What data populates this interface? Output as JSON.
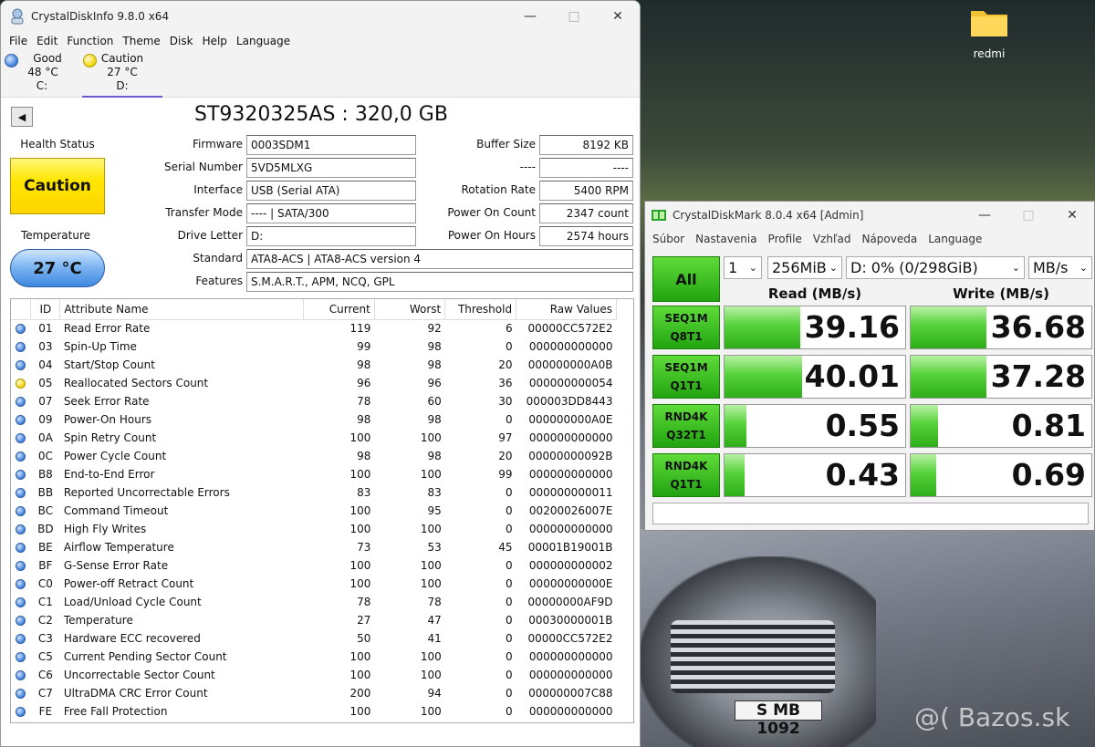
{
  "desktop": {
    "folder_label": "redmi",
    "plate": "S MB 1092",
    "watermark": "@( Bazos.sk"
  },
  "cdi": {
    "title": "CrystalDiskInfo 9.8.0 x64",
    "menu": [
      "File",
      "Edit",
      "Function",
      "Theme",
      "Disk",
      "Help",
      "Language"
    ],
    "drives": [
      {
        "status": "Good",
        "temp": "48 °C",
        "letter": "C:"
      },
      {
        "status": "Caution",
        "temp": "27 °C",
        "letter": "D:"
      }
    ],
    "disk_title": "ST9320325AS : 320,0 GB",
    "health_label": "Health Status",
    "health_value": "Caution",
    "temp_label": "Temperature",
    "temp_value": "27 °C",
    "fields": {
      "firmware_label": "Firmware",
      "firmware": "0003SDM1",
      "serial_label": "Serial Number",
      "serial": "5VD5MLXG",
      "interface_label": "Interface",
      "interface": "USB (Serial ATA)",
      "transfer_label": "Transfer Mode",
      "transfer": "---- | SATA/300",
      "drive_letter_label": "Drive Letter",
      "drive_letter": "D:",
      "standard_label": "Standard",
      "standard": "ATA8-ACS | ATA8-ACS version 4",
      "features_label": "Features",
      "features": "S.M.A.R.T., APM, NCQ, GPL",
      "buffer_label": "Buffer Size",
      "buffer": "8192 KB",
      "blank_label": "----",
      "blank": "----",
      "rotation_label": "Rotation Rate",
      "rotation": "5400 RPM",
      "power_count_label": "Power On Count",
      "power_count": "2347 count",
      "power_hours_label": "Power On Hours",
      "power_hours": "2574 hours"
    },
    "smart_headers": [
      "ID",
      "Attribute Name",
      "Current",
      "Worst",
      "Threshold",
      "Raw Values"
    ],
    "smart_rows": [
      [
        "blue",
        "01",
        "Read Error Rate",
        "119",
        "92",
        "6",
        "00000CC572E2"
      ],
      [
        "blue",
        "03",
        "Spin-Up Time",
        "99",
        "98",
        "0",
        "000000000000"
      ],
      [
        "blue",
        "04",
        "Start/Stop Count",
        "98",
        "98",
        "20",
        "000000000A0B"
      ],
      [
        "yellow",
        "05",
        "Reallocated Sectors Count",
        "96",
        "96",
        "36",
        "000000000054"
      ],
      [
        "blue",
        "07",
        "Seek Error Rate",
        "78",
        "60",
        "30",
        "000003DD8443"
      ],
      [
        "blue",
        "09",
        "Power-On Hours",
        "98",
        "98",
        "0",
        "000000000A0E"
      ],
      [
        "blue",
        "0A",
        "Spin Retry Count",
        "100",
        "100",
        "97",
        "000000000000"
      ],
      [
        "blue",
        "0C",
        "Power Cycle Count",
        "98",
        "98",
        "20",
        "00000000092B"
      ],
      [
        "blue",
        "B8",
        "End-to-End Error",
        "100",
        "100",
        "99",
        "000000000000"
      ],
      [
        "blue",
        "BB",
        "Reported Uncorrectable Errors",
        "83",
        "83",
        "0",
        "000000000011"
      ],
      [
        "blue",
        "BC",
        "Command Timeout",
        "100",
        "95",
        "0",
        "00200026007E"
      ],
      [
        "blue",
        "BD",
        "High Fly Writes",
        "100",
        "100",
        "0",
        "000000000000"
      ],
      [
        "blue",
        "BE",
        "Airflow Temperature",
        "73",
        "53",
        "45",
        "00001B19001B"
      ],
      [
        "blue",
        "BF",
        "G-Sense Error Rate",
        "100",
        "100",
        "0",
        "000000000002"
      ],
      [
        "blue",
        "C0",
        "Power-off Retract Count",
        "100",
        "100",
        "0",
        "00000000000E"
      ],
      [
        "blue",
        "C1",
        "Load/Unload Cycle Count",
        "78",
        "78",
        "0",
        "00000000AF9D"
      ],
      [
        "blue",
        "C2",
        "Temperature",
        "27",
        "47",
        "0",
        "00030000001B"
      ],
      [
        "blue",
        "C3",
        "Hardware ECC recovered",
        "50",
        "41",
        "0",
        "00000CC572E2"
      ],
      [
        "blue",
        "C5",
        "Current Pending Sector Count",
        "100",
        "100",
        "0",
        "000000000000"
      ],
      [
        "blue",
        "C6",
        "Uncorrectable Sector Count",
        "100",
        "100",
        "0",
        "000000000000"
      ],
      [
        "blue",
        "C7",
        "UltraDMA CRC Error Count",
        "200",
        "94",
        "0",
        "000000007C88"
      ],
      [
        "blue",
        "FE",
        "Free Fall Protection",
        "100",
        "100",
        "0",
        "000000000000"
      ]
    ]
  },
  "cdm": {
    "title": "CrystalDiskMark 8.0.4 x64 [Admin]",
    "menu": [
      "Súbor",
      "Nastavenia",
      "Profile",
      "Vzhľad",
      "Nápoveda",
      "Language"
    ],
    "all_label": "All",
    "count": "1",
    "size": "256MiB",
    "drive": "D: 0% (0/298GiB)",
    "unit": "MB/s",
    "read_header": "Read (MB/s)",
    "write_header": "Write (MB/s)",
    "tests": [
      {
        "l1": "SEQ1M",
        "l2": "Q8T1",
        "read": "39.16",
        "write": "36.68",
        "read_fill": 0.42,
        "write_fill": 0.42
      },
      {
        "l1": "SEQ1M",
        "l2": "Q1T1",
        "read": "40.01",
        "write": "37.28",
        "read_fill": 0.43,
        "write_fill": 0.42
      },
      {
        "l1": "RND4K",
        "l2": "Q32T1",
        "read": "0.55",
        "write": "0.81",
        "read_fill": 0.12,
        "write_fill": 0.15
      },
      {
        "l1": "RND4K",
        "l2": "Q1T1",
        "read": "0.43",
        "write": "0.69",
        "read_fill": 0.11,
        "write_fill": 0.14
      }
    ]
  }
}
